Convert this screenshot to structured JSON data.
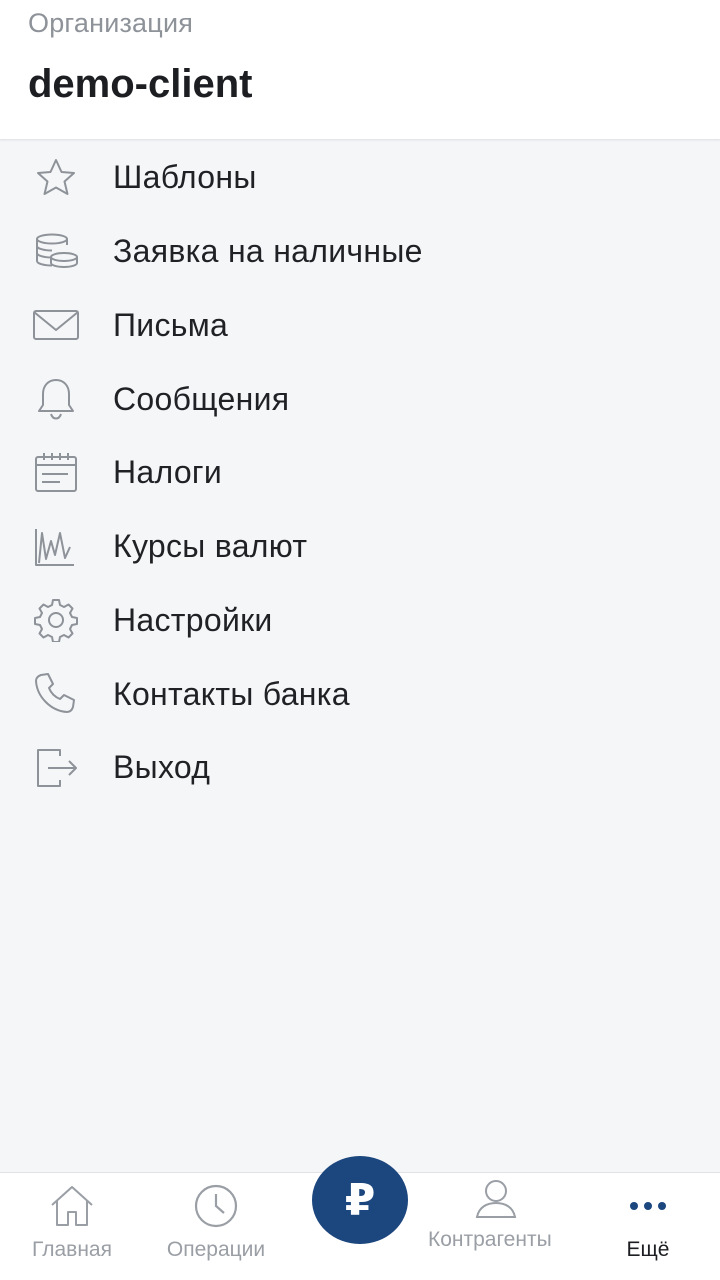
{
  "header": {
    "org_label": "Организация",
    "org_name": "demo-client"
  },
  "menu": {
    "items": [
      {
        "label": "Шаблоны",
        "icon": "star-icon"
      },
      {
        "label": "Заявка на наличные",
        "icon": "coins-icon"
      },
      {
        "label": "Письма",
        "icon": "envelope-icon"
      },
      {
        "label": "Сообщения",
        "icon": "bell-icon"
      },
      {
        "label": "Налоги",
        "icon": "calendar-icon"
      },
      {
        "label": "Курсы валют",
        "icon": "chart-icon"
      },
      {
        "label": "Настройки",
        "icon": "gear-icon"
      },
      {
        "label": "Контакты банка",
        "icon": "phone-icon"
      },
      {
        "label": "Выход",
        "icon": "logout-icon"
      }
    ]
  },
  "tabbar": {
    "home": "Главная",
    "operations": "Операции",
    "pay_symbol": "₽",
    "contractors": "Контрагенты",
    "more": "Ещё",
    "more_dots": "•••"
  },
  "colors": {
    "accent": "#1b467e",
    "icon_gray": "#9a9ea5",
    "background": "#f5f6f8"
  }
}
